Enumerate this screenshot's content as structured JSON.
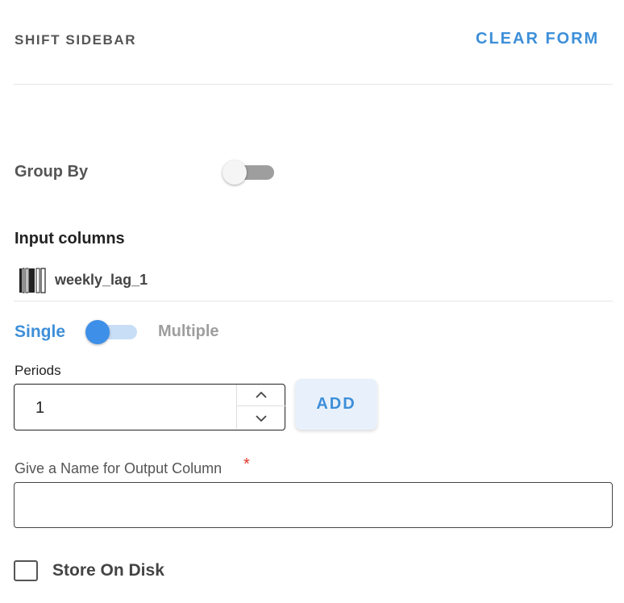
{
  "header": {
    "title": "SHIFT SIDEBAR",
    "clear_label": "CLEAR FORM"
  },
  "group_by": {
    "label": "Group By",
    "enabled": false
  },
  "input_columns": {
    "label": "Input columns",
    "items": [
      {
        "name": "weekly_lag_1",
        "icon": "barcode-icon"
      }
    ]
  },
  "mode": {
    "single_label": "Single",
    "multiple_label": "Multiple",
    "selected": "Single"
  },
  "periods": {
    "label": "Periods",
    "value": "1",
    "add_label": "ADD"
  },
  "output_name": {
    "label": "Give a Name for Output Column",
    "required_mark": "*",
    "value": "",
    "placeholder": ""
  },
  "store_on_disk": {
    "label": "Store On Disk",
    "checked": false
  },
  "colors": {
    "accent": "#3d8fd9",
    "toggle_on_knob": "#3d8fe8",
    "toggle_on_track": "#c8def7",
    "toggle_off_track": "#9e9e9e",
    "required": "#e0372b",
    "add_button_bg": "#e8f1fb"
  }
}
